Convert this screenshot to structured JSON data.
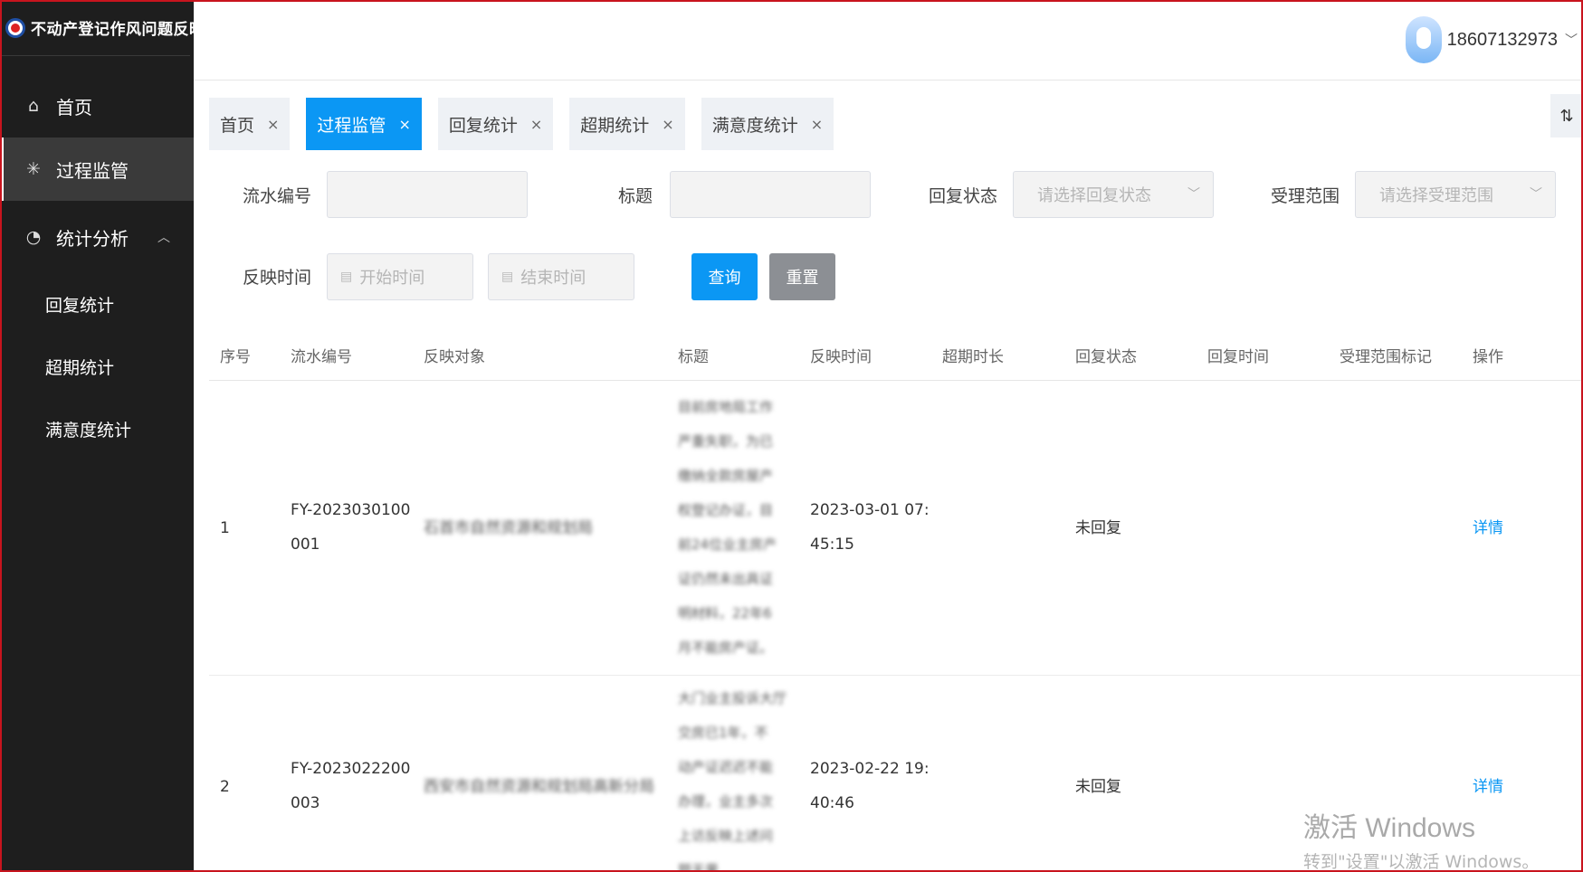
{
  "app": {
    "title": "不动产登记作风问题反映"
  },
  "sidebar": {
    "items": [
      {
        "label": "首页"
      },
      {
        "label": "过程监管"
      },
      {
        "label": "统计分析"
      }
    ],
    "sub_items": [
      {
        "label": "回复统计"
      },
      {
        "label": "超期统计"
      },
      {
        "label": "满意度统计"
      }
    ]
  },
  "header": {
    "user": "18607132973"
  },
  "tabs": [
    {
      "label": "首页"
    },
    {
      "label": "过程监管"
    },
    {
      "label": "回复统计"
    },
    {
      "label": "超期统计"
    },
    {
      "label": "满意度统计"
    }
  ],
  "filters": {
    "serial_label": "流水编号",
    "title_label": "标题",
    "reply_status_label": "回复状态",
    "reply_status_placeholder": "请选择回复状态",
    "scope_label": "受理范围",
    "scope_placeholder": "请选择受理范围",
    "time_label": "反映时间",
    "start_placeholder": "开始时间",
    "end_placeholder": "结束时间",
    "query_label": "查询",
    "reset_label": "重置"
  },
  "table": {
    "columns": [
      "序号",
      "流水编号",
      "反映对象",
      "标题",
      "反映时间",
      "超期时长",
      "回复状态",
      "回复时间",
      "受理范围标记",
      "操作"
    ],
    "rows": [
      {
        "index": "1",
        "serial_a": "FY-2023030100",
        "serial_b": "001",
        "target": "石首市自然资源和规划局",
        "title_lines": [
          "目前房地局工作",
          "严重失职，为已",
          "缴纳全款房屋产",
          "权登记办证，目",
          "前24位业主房产",
          "证仍然未出具证",
          "明材料，22年6",
          "月不能房产证。"
        ],
        "time_a": "2023-03-01 07:",
        "time_b": "45:15",
        "reply_status": "未回复",
        "action": "详情"
      },
      {
        "index": "2",
        "serial_a": "FY-2023022200",
        "serial_b": "003",
        "target": "西安市自然资源和规划局高新分局",
        "title_lines": [
          "大门业主投诉大厅",
          "交房已1年，不",
          "动产证迟迟不能",
          "办理，业主多次",
          "上访反映上述问",
          "题无果"
        ],
        "time_a": "2023-02-22 19:",
        "time_b": "40:46",
        "reply_status": "未回复",
        "action": "详情"
      }
    ]
  },
  "watermark": {
    "line1": "激活 Windows",
    "line2": "转到\"设置\"以激活 Windows。"
  }
}
